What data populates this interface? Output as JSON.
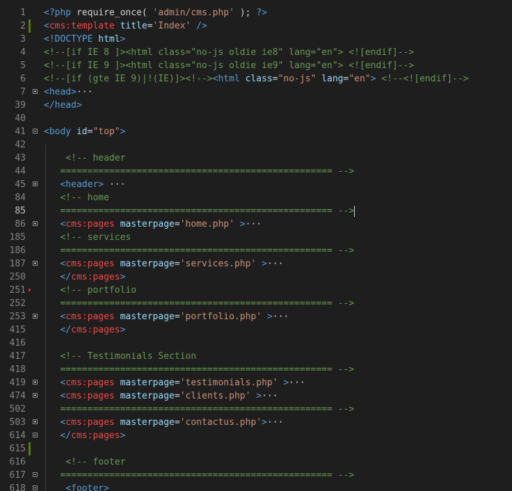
{
  "colors": {
    "background": "#1e1e1e",
    "line_number": "#858585",
    "tag": "#569cd6",
    "attribute": "#9cdcfe",
    "string": "#ce9178",
    "comment": "#6a9955",
    "text": "#d4d4d4",
    "custom_tag": "#f44747"
  },
  "editor": {
    "current_line": "85",
    "lines": [
      {
        "n": "1",
        "tokens": [
          {
            "t": "<?php",
            "c": "tag"
          },
          {
            "t": " require_once( ",
            "c": "text"
          },
          {
            "t": "'admin/cms.php'",
            "c": "string"
          },
          {
            "t": " ); ",
            "c": "text"
          },
          {
            "t": "?>",
            "c": "tag"
          }
        ]
      },
      {
        "n": "2",
        "mark": "green",
        "tokens": [
          {
            "t": "<",
            "c": "tag"
          },
          {
            "t": "cms:template",
            "c": "custom_tag"
          },
          {
            "t": " title",
            "c": "attribute"
          },
          {
            "t": "=",
            "c": "text"
          },
          {
            "t": "'Index'",
            "c": "string"
          },
          {
            "t": " />",
            "c": "tag"
          }
        ]
      },
      {
        "n": "3",
        "tokens": [
          {
            "t": "<!DOCTYPE ",
            "c": "tag"
          },
          {
            "t": "html",
            "c": "attribute"
          },
          {
            "t": ">",
            "c": "tag"
          }
        ]
      },
      {
        "n": "4",
        "tokens": [
          {
            "t": "<!--[if IE 8 ]><html class=\"no-js oldie ie8\" lang=\"en\"> <![endif]-->",
            "c": "comment"
          }
        ]
      },
      {
        "n": "5",
        "tokens": [
          {
            "t": "<!--[if IE 9 ]><html class=\"no-js oldie ie9\" lang=\"en\"> <![endif]-->",
            "c": "comment"
          }
        ]
      },
      {
        "n": "6",
        "tokens": [
          {
            "t": "<!--[if (gte IE 9)|!(IE)]><!-->",
            "c": "comment"
          },
          {
            "t": "<html",
            "c": "tag"
          },
          {
            "t": " class",
            "c": "attribute"
          },
          {
            "t": "=",
            "c": "text"
          },
          {
            "t": "\"no-js\"",
            "c": "string"
          },
          {
            "t": " lang",
            "c": "attribute"
          },
          {
            "t": "=",
            "c": "text"
          },
          {
            "t": "\"en\"",
            "c": "string"
          },
          {
            "t": ">",
            "c": "tag"
          },
          {
            "t": " <!--<![endif]-->",
            "c": "comment"
          }
        ]
      },
      {
        "n": "7",
        "fold": "plus",
        "tokens": [
          {
            "t": "<head>",
            "c": "tag"
          }
        ],
        "ellipsis": "···"
      },
      {
        "n": "39",
        "tokens": [
          {
            "t": "</head>",
            "c": "tag"
          }
        ]
      },
      {
        "n": "40",
        "tokens": []
      },
      {
        "n": "41",
        "fold": "minus",
        "tokens": [
          {
            "t": "<body",
            "c": "tag"
          },
          {
            "t": " id",
            "c": "attribute"
          },
          {
            "t": "=",
            "c": "text"
          },
          {
            "t": "\"top\"",
            "c": "string"
          },
          {
            "t": ">",
            "c": "tag"
          }
        ]
      },
      {
        "n": "42",
        "tokens": []
      },
      {
        "n": "43",
        "tokens": [
          {
            "t": "    <!-- header",
            "c": "comment"
          }
        ]
      },
      {
        "n": "44",
        "tokens": [
          {
            "t": "   ================================================== -->",
            "c": "comment"
          }
        ]
      },
      {
        "n": "45",
        "fold": "plus",
        "tokens": [
          {
            "t": "   ",
            "c": "text"
          },
          {
            "t": "<header>",
            "c": "tag"
          },
          {
            "t": " ",
            "c": "text"
          }
        ],
        "ellipsis": "···"
      },
      {
        "n": "84",
        "tokens": [
          {
            "t": "   <!-- home",
            "c": "comment"
          }
        ]
      },
      {
        "n": "85",
        "cursor": true,
        "tokens": [
          {
            "t": "   ================================================== -->",
            "c": "comment"
          }
        ]
      },
      {
        "n": "86",
        "fold": "plus",
        "tokens": [
          {
            "t": "   ",
            "c": "text"
          },
          {
            "t": "<",
            "c": "tag"
          },
          {
            "t": "cms:pages",
            "c": "custom_tag"
          },
          {
            "t": " masterpage",
            "c": "attribute"
          },
          {
            "t": "=",
            "c": "text"
          },
          {
            "t": "'home.php'",
            "c": "string"
          },
          {
            "t": " >",
            "c": "tag"
          }
        ],
        "ellipsis": "···"
      },
      {
        "n": "185",
        "tokens": [
          {
            "t": "   <!-- services",
            "c": "comment"
          }
        ]
      },
      {
        "n": "186",
        "tokens": [
          {
            "t": "   ================================================== -->",
            "c": "comment"
          }
        ]
      },
      {
        "n": "187",
        "fold": "plus",
        "tokens": [
          {
            "t": "   ",
            "c": "text"
          },
          {
            "t": "<",
            "c": "tag"
          },
          {
            "t": "cms:pages",
            "c": "custom_tag"
          },
          {
            "t": " masterpage",
            "c": "attribute"
          },
          {
            "t": "=",
            "c": "text"
          },
          {
            "t": "'services.php'",
            "c": "string"
          },
          {
            "t": " >",
            "c": "tag"
          }
        ],
        "ellipsis": "···"
      },
      {
        "n": "250",
        "tokens": [
          {
            "t": "   </",
            "c": "tag"
          },
          {
            "t": "cms:pages",
            "c": "custom_tag"
          },
          {
            "t": ">",
            "c": "tag"
          }
        ]
      },
      {
        "n": "251",
        "mark": "red",
        "tokens": [
          {
            "t": "   <!-- portfolio",
            "c": "comment"
          }
        ]
      },
      {
        "n": "252",
        "tokens": [
          {
            "t": "   ================================================== -->",
            "c": "comment"
          }
        ]
      },
      {
        "n": "253",
        "fold": "plus",
        "tokens": [
          {
            "t": "   ",
            "c": "text"
          },
          {
            "t": "<",
            "c": "tag"
          },
          {
            "t": "cms:pages",
            "c": "custom_tag"
          },
          {
            "t": " masterpage",
            "c": "attribute"
          },
          {
            "t": "=",
            "c": "text"
          },
          {
            "t": "'portfolio.php'",
            "c": "string"
          },
          {
            "t": " >",
            "c": "tag"
          }
        ],
        "ellipsis": "···"
      },
      {
        "n": "415",
        "tokens": [
          {
            "t": "   </",
            "c": "tag"
          },
          {
            "t": "cms:pages",
            "c": "custom_tag"
          },
          {
            "t": ">",
            "c": "tag"
          }
        ]
      },
      {
        "n": "416",
        "tokens": []
      },
      {
        "n": "417",
        "tokens": [
          {
            "t": "   <!-- Testimonials Section",
            "c": "comment"
          }
        ]
      },
      {
        "n": "418",
        "tokens": [
          {
            "t": "   ================================================== -->",
            "c": "comment"
          }
        ]
      },
      {
        "n": "419",
        "fold": "plus",
        "tokens": [
          {
            "t": "   ",
            "c": "text"
          },
          {
            "t": "<",
            "c": "tag"
          },
          {
            "t": "cms:pages",
            "c": "custom_tag"
          },
          {
            "t": " masterpage",
            "c": "attribute"
          },
          {
            "t": "=",
            "c": "text"
          },
          {
            "t": "'testimonials.php'",
            "c": "string"
          },
          {
            "t": " >",
            "c": "tag"
          }
        ],
        "ellipsis": "···"
      },
      {
        "n": "474",
        "fold": "plus",
        "tokens": [
          {
            "t": "   ",
            "c": "text"
          },
          {
            "t": "<",
            "c": "tag"
          },
          {
            "t": "cms:pages",
            "c": "custom_tag"
          },
          {
            "t": " masterpage",
            "c": "attribute"
          },
          {
            "t": "=",
            "c": "text"
          },
          {
            "t": "'clients.php'",
            "c": "string"
          },
          {
            "t": " >",
            "c": "tag"
          }
        ],
        "ellipsis": "···"
      },
      {
        "n": "502",
        "tokens": [
          {
            "t": "   ================================================== -->",
            "c": "comment"
          }
        ]
      },
      {
        "n": "503",
        "fold": "plus",
        "tokens": [
          {
            "t": "   ",
            "c": "text"
          },
          {
            "t": "<",
            "c": "tag"
          },
          {
            "t": "cms:pages",
            "c": "custom_tag"
          },
          {
            "t": " masterpage",
            "c": "attribute"
          },
          {
            "t": "=",
            "c": "text"
          },
          {
            "t": "'contactus.php'",
            "c": "string"
          },
          {
            "t": ">",
            "c": "tag"
          }
        ],
        "ellipsis": "···"
      },
      {
        "n": "614",
        "fold": "minus",
        "tokens": [
          {
            "t": "   </",
            "c": "tag"
          },
          {
            "t": "cms:pages",
            "c": "custom_tag"
          },
          {
            "t": ">",
            "c": "tag"
          }
        ]
      },
      {
        "n": "615",
        "mark": "green",
        "tokens": []
      },
      {
        "n": "616",
        "tokens": [
          {
            "t": "    <!-- footer",
            "c": "comment"
          }
        ]
      },
      {
        "n": "617",
        "fold": "minus",
        "tokens": [
          {
            "t": "   ================================================== -->",
            "c": "comment"
          }
        ]
      },
      {
        "n": "618",
        "fold": "minus",
        "tokens": [
          {
            "t": "    ",
            "c": "text"
          },
          {
            "t": "<footer>",
            "c": "tag"
          }
        ]
      }
    ]
  }
}
